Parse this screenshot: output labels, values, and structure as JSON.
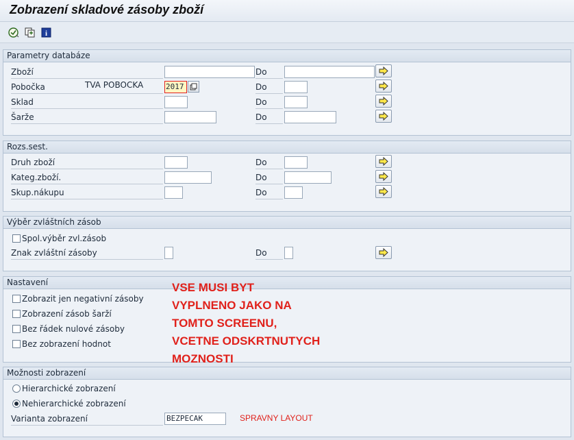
{
  "window": {
    "title": "Zobrazení skladové zásoby zboží"
  },
  "toolbar": {
    "execute_icon": "execute-icon",
    "variant_icon": "get-variant-icon",
    "info_icon": "info-icon",
    "info_glyph": "i"
  },
  "db": {
    "header": "Parametry databáze",
    "do_label": "Do",
    "zbozi_label": "Zboží",
    "pobocka_label": "Pobočka",
    "pobocka_text": "TVA POBOCKA",
    "pobocka_value": "2017",
    "sklad_label": "Sklad",
    "sarze_label": "Šarže"
  },
  "rozs": {
    "header": "Rozs.sest.",
    "do_label": "Do",
    "druh_label": "Druh zboží",
    "kateg_label": "Kateg.zboží.",
    "skup_label": "Skup.nákupu"
  },
  "zvl": {
    "header": "Výběr zvláštních zásob",
    "do_label": "Do",
    "spol_label": "Spol.výběr zvl.zásob",
    "znak_label": "Znak zvláštní zásoby"
  },
  "nast": {
    "header": "Nastavení",
    "opt1": "Zobrazit jen negativní zásoby",
    "opt2": "Zobrazení zásob šarží",
    "opt3": "Bez řádek nulové zásoby",
    "opt4": "Bez zobrazení hodnot"
  },
  "annotation": {
    "line1": "VSE MUSI BYT",
    "line2": "VYPLNENO JAKO NA",
    "line3": "TOMTO SCREENU,",
    "line4": "VCETNE ODSKRTNUTYCH",
    "line5": "MOZNOSTI",
    "color": "#e0211b"
  },
  "moz": {
    "header": "Možnosti zobrazení",
    "radio1": "Hierarchické zobrazení",
    "radio2": "Nehierarchické zobrazení",
    "selected": "Nehierarchické zobrazení",
    "varianta_label": "Varianta zobrazení",
    "varianta_value": "BEZPECAK",
    "layout_note": "SPRAVNY LAYOUT"
  }
}
